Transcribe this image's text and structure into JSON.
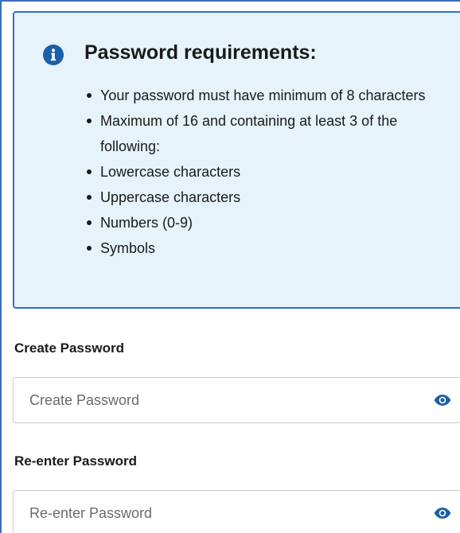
{
  "info": {
    "icon": "info-icon",
    "title": "Password requirements:",
    "items": [
      "Your password must have minimum of 8 characters",
      "Maximum of 16 and containing at least 3 of the following:",
      "Lowercase characters",
      "Uppercase characters",
      "Numbers (0-9)",
      "Symbols"
    ]
  },
  "create": {
    "label": "Create Password",
    "placeholder": "Create Password",
    "value": "",
    "icon": "eye-icon"
  },
  "reenter": {
    "label": "Re-enter Password",
    "placeholder": "Re-enter Password",
    "value": "",
    "icon": "eye-icon"
  },
  "colors": {
    "accent": "#2a74c4",
    "info_background": "#e6f3fb",
    "icon_color": "#1b5fa8"
  }
}
